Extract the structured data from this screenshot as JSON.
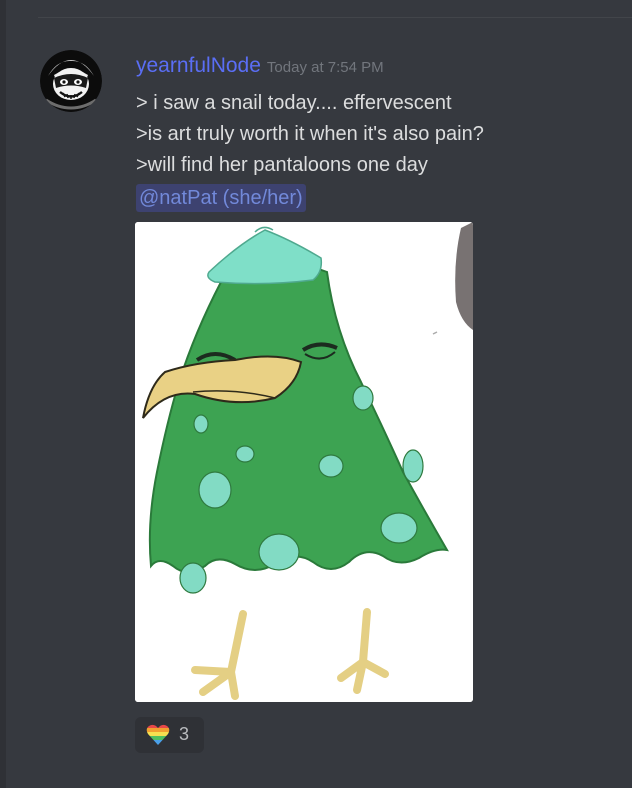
{
  "message": {
    "username": "yearnfulNode",
    "timestamp": "Today at 7:54 PM",
    "lines": [
      "> i saw a snail today.... effervescent",
      ">is art truly worth it when it's also pain?",
      ">will find her pantaloons one day"
    ],
    "mention": "@natPat (she/her)"
  },
  "avatar": {
    "icon": "masked-face-avatar-icon"
  },
  "attachment": {
    "description": "drawing of a green bird with a blue hat"
  },
  "reaction": {
    "emoji": "rainbow-heart-icon",
    "count": "3"
  },
  "colors": {
    "background": "#36393f",
    "username": "#5a6ef5",
    "mention_bg": "#3d4270",
    "mention_text": "#7289da",
    "text": "#dcddde",
    "timestamp": "#72767d"
  }
}
